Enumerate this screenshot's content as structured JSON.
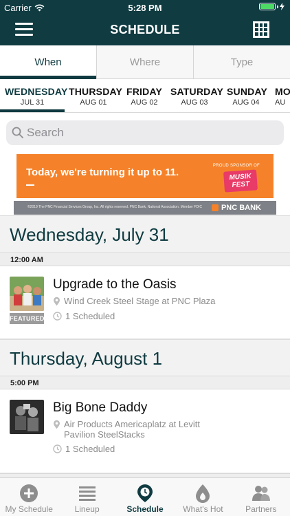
{
  "status": {
    "carrier": "Carrier",
    "time": "5:28 PM"
  },
  "nav": {
    "title": "SCHEDULE"
  },
  "filter_tabs": [
    {
      "label": "When",
      "active": true
    },
    {
      "label": "Where",
      "active": false
    },
    {
      "label": "Type",
      "active": false
    }
  ],
  "days": [
    {
      "name": "WEDNESDAY",
      "date": "JUL 31",
      "active": true
    },
    {
      "name": "THURSDAY",
      "date": "AUG 01",
      "active": false
    },
    {
      "name": "FRIDAY",
      "date": "AUG 02",
      "active": false
    },
    {
      "name": "SATURDAY",
      "date": "AUG 03",
      "active": false
    },
    {
      "name": "SUNDAY",
      "date": "AUG 04",
      "active": false
    },
    {
      "name": "MO",
      "date": "AU",
      "active": false
    }
  ],
  "search": {
    "placeholder": "Search"
  },
  "ad": {
    "headline": "Today, we're turning it up to 11.",
    "sponsor": "PROUD SPONSOR OF",
    "logo": "MUSIK FEST",
    "legal": "©2019 The PNC Financial Services Group, Inc. All rights reserved. PNC Bank, National Association. Member FDIC",
    "bank": "PNC BANK"
  },
  "sections": [
    {
      "title": "Wednesday, July 31",
      "time": "12:00 AM",
      "event": {
        "title": "Upgrade to the Oasis",
        "venue": "Wind Creek Steel Stage at PNC Plaza",
        "scheduled": "1 Scheduled",
        "badge": "FEATURED"
      }
    },
    {
      "title": "Thursday, August 1",
      "time": "5:00 PM",
      "event": {
        "title": "Big Bone Daddy",
        "venue_line1": "Air Products Americaplatz at Levitt",
        "venue_line2": "Pavilion SteelStacks",
        "scheduled": "1 Scheduled"
      }
    }
  ],
  "tabbar": [
    {
      "label": "My Schedule",
      "icon": "plus-circle-icon",
      "active": false
    },
    {
      "label": "Lineup",
      "icon": "list-icon",
      "active": false
    },
    {
      "label": "Schedule",
      "icon": "clock-pin-icon",
      "active": true
    },
    {
      "label": "What's Hot",
      "icon": "flame-icon",
      "active": false
    },
    {
      "label": "Partners",
      "icon": "people-icon",
      "active": false
    }
  ],
  "colors": {
    "primary": "#0f3b41",
    "ad_orange": "#f5822a",
    "battery": "#4cd964"
  }
}
